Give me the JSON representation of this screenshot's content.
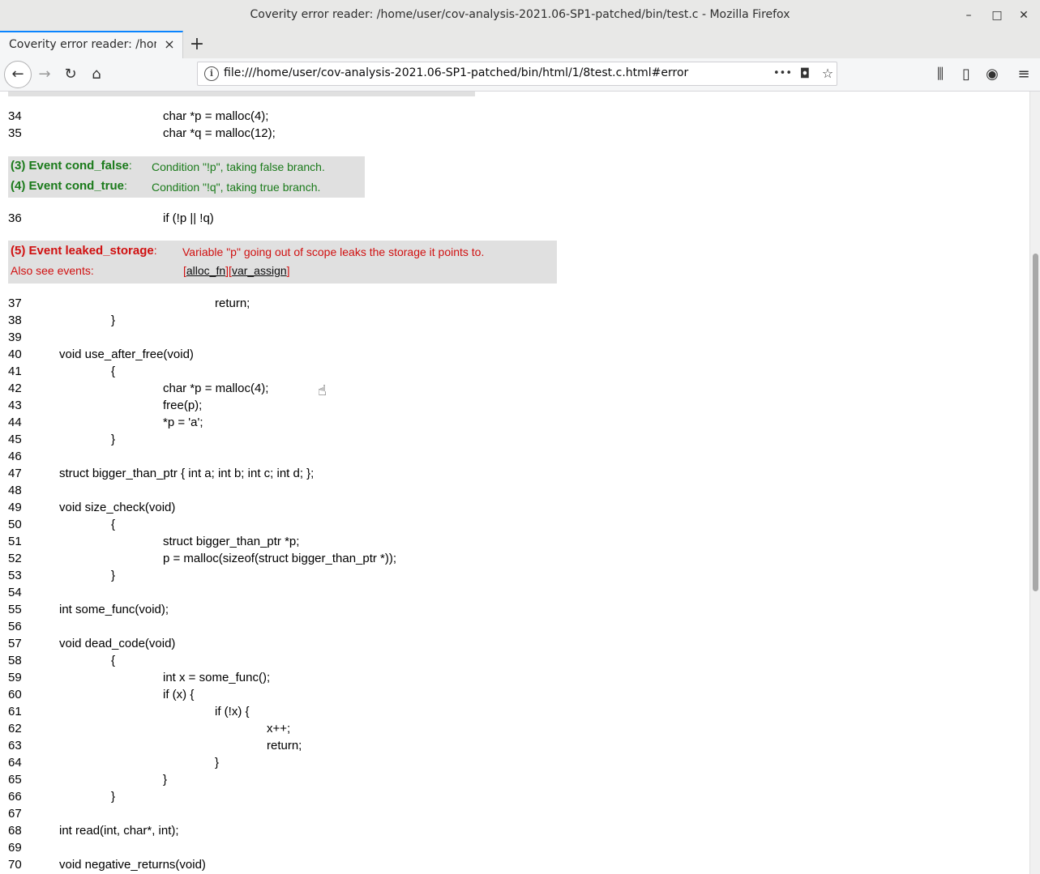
{
  "window": {
    "title": "Coverity error reader: /home/user/cov-analysis-2021.06-SP1-patched/bin/test.c - Mozilla Firefox",
    "minimize": "–",
    "maximize": "□",
    "close": "✕"
  },
  "tabs": [
    {
      "label": "Coverity error reader: /home/user/cov-analysis-2021.06-SP1-patched/bin/test.c",
      "close": "×"
    }
  ],
  "newtab_label": "+",
  "nav": {
    "back": "←",
    "forward": "→",
    "reload": "↻",
    "home": "⌂",
    "url": "file:///home/user/cov-analysis-2021.06-SP1-patched/bin/html/1/8test.c.html#error",
    "page_actions": "•••",
    "pocket": "◘",
    "bookmark": "☆",
    "library": "⫼",
    "sidebar": "▯",
    "account": "◉",
    "menu": "≡"
  },
  "events": {
    "cond_false": {
      "head": "(3) Event cond_false",
      "colon": ":",
      "msg": "Condition \"!p\", taking false branch."
    },
    "cond_true": {
      "head": "(4) Event cond_true",
      "colon": ":",
      "msg": "Condition \"!q\", taking true branch."
    },
    "leaked_storage": {
      "head": "(5) Event leaked_storage",
      "colon": ":",
      "msg": "Variable \"p\" going out of scope leaks the storage it points to."
    },
    "also_see": {
      "label": "Also see events:",
      "links": [
        "alloc_fn",
        "var_assign"
      ]
    }
  },
  "code": [
    {
      "n": "34",
      "text": "char *p = malloc(4);"
    },
    {
      "n": "35",
      "text": "char *q = malloc(12);"
    },
    {
      "n": "36",
      "text": "if (!p || !q)"
    },
    {
      "n": "37",
      "text": "return;"
    },
    {
      "n": "38",
      "text": "}"
    },
    {
      "n": "39",
      "text": ""
    },
    {
      "n": "40",
      "text": "void use_after_free(void)"
    },
    {
      "n": "41",
      "text": "{"
    },
    {
      "n": "42",
      "text": "char *p = malloc(4);"
    },
    {
      "n": "43",
      "text": "free(p);"
    },
    {
      "n": "44",
      "text": "*p = 'a';"
    },
    {
      "n": "45",
      "text": "}"
    },
    {
      "n": "46",
      "text": ""
    },
    {
      "n": "47",
      "text": "struct bigger_than_ptr { int a; int b; int c; int d; };"
    },
    {
      "n": "48",
      "text": ""
    },
    {
      "n": "49",
      "text": "void size_check(void)"
    },
    {
      "n": "50",
      "text": "{"
    },
    {
      "n": "51",
      "text": "struct bigger_than_ptr *p;"
    },
    {
      "n": "52",
      "text": "p = malloc(sizeof(struct bigger_than_ptr *));"
    },
    {
      "n": "53",
      "text": "}"
    },
    {
      "n": "54",
      "text": ""
    },
    {
      "n": "55",
      "text": "int some_func(void);"
    },
    {
      "n": "56",
      "text": ""
    },
    {
      "n": "57",
      "text": "void dead_code(void)"
    },
    {
      "n": "58",
      "text": "{"
    },
    {
      "n": "59",
      "text": "int x = some_func();"
    },
    {
      "n": "60",
      "text": "if (x) {"
    },
    {
      "n": "61",
      "text": "if (!x) {"
    },
    {
      "n": "62",
      "text": "x++;"
    },
    {
      "n": "63",
      "text": "return;"
    },
    {
      "n": "64",
      "text": "}"
    },
    {
      "n": "65",
      "text": "}"
    },
    {
      "n": "66",
      "text": "}"
    },
    {
      "n": "67",
      "text": ""
    },
    {
      "n": "68",
      "text": "int read(int, char*, int);"
    },
    {
      "n": "69",
      "text": ""
    },
    {
      "n": "70",
      "text": "void negative_returns(void)"
    }
  ]
}
